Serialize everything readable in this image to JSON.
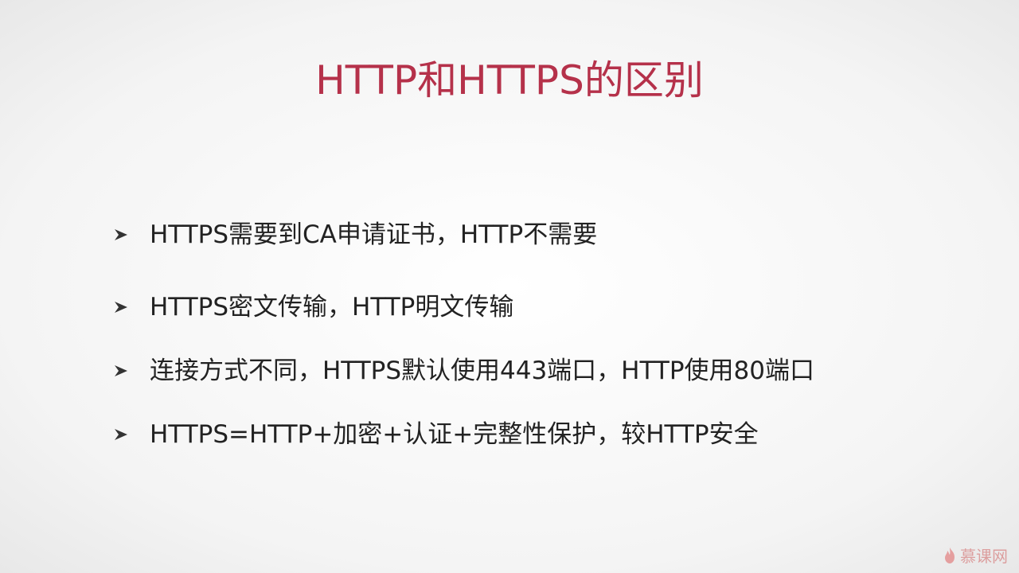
{
  "slide": {
    "title": "HTTP和HTTPS的区别",
    "title_color": "#b5314a",
    "bullet_icon": "arrow-bullet-icon",
    "bullets": [
      "HTTPS需要到CA申请证书，HTTP不需要",
      "HTTPS密文传输，HTTP明文传输",
      "连接方式不同，HTTPS默认使用443端口，HTTP使用80端口",
      "HTTPS=HTTP+加密+认证+完整性保护，较HTTP安全"
    ]
  },
  "watermark": {
    "text": "慕课网",
    "icon": "flame-logo-icon"
  }
}
